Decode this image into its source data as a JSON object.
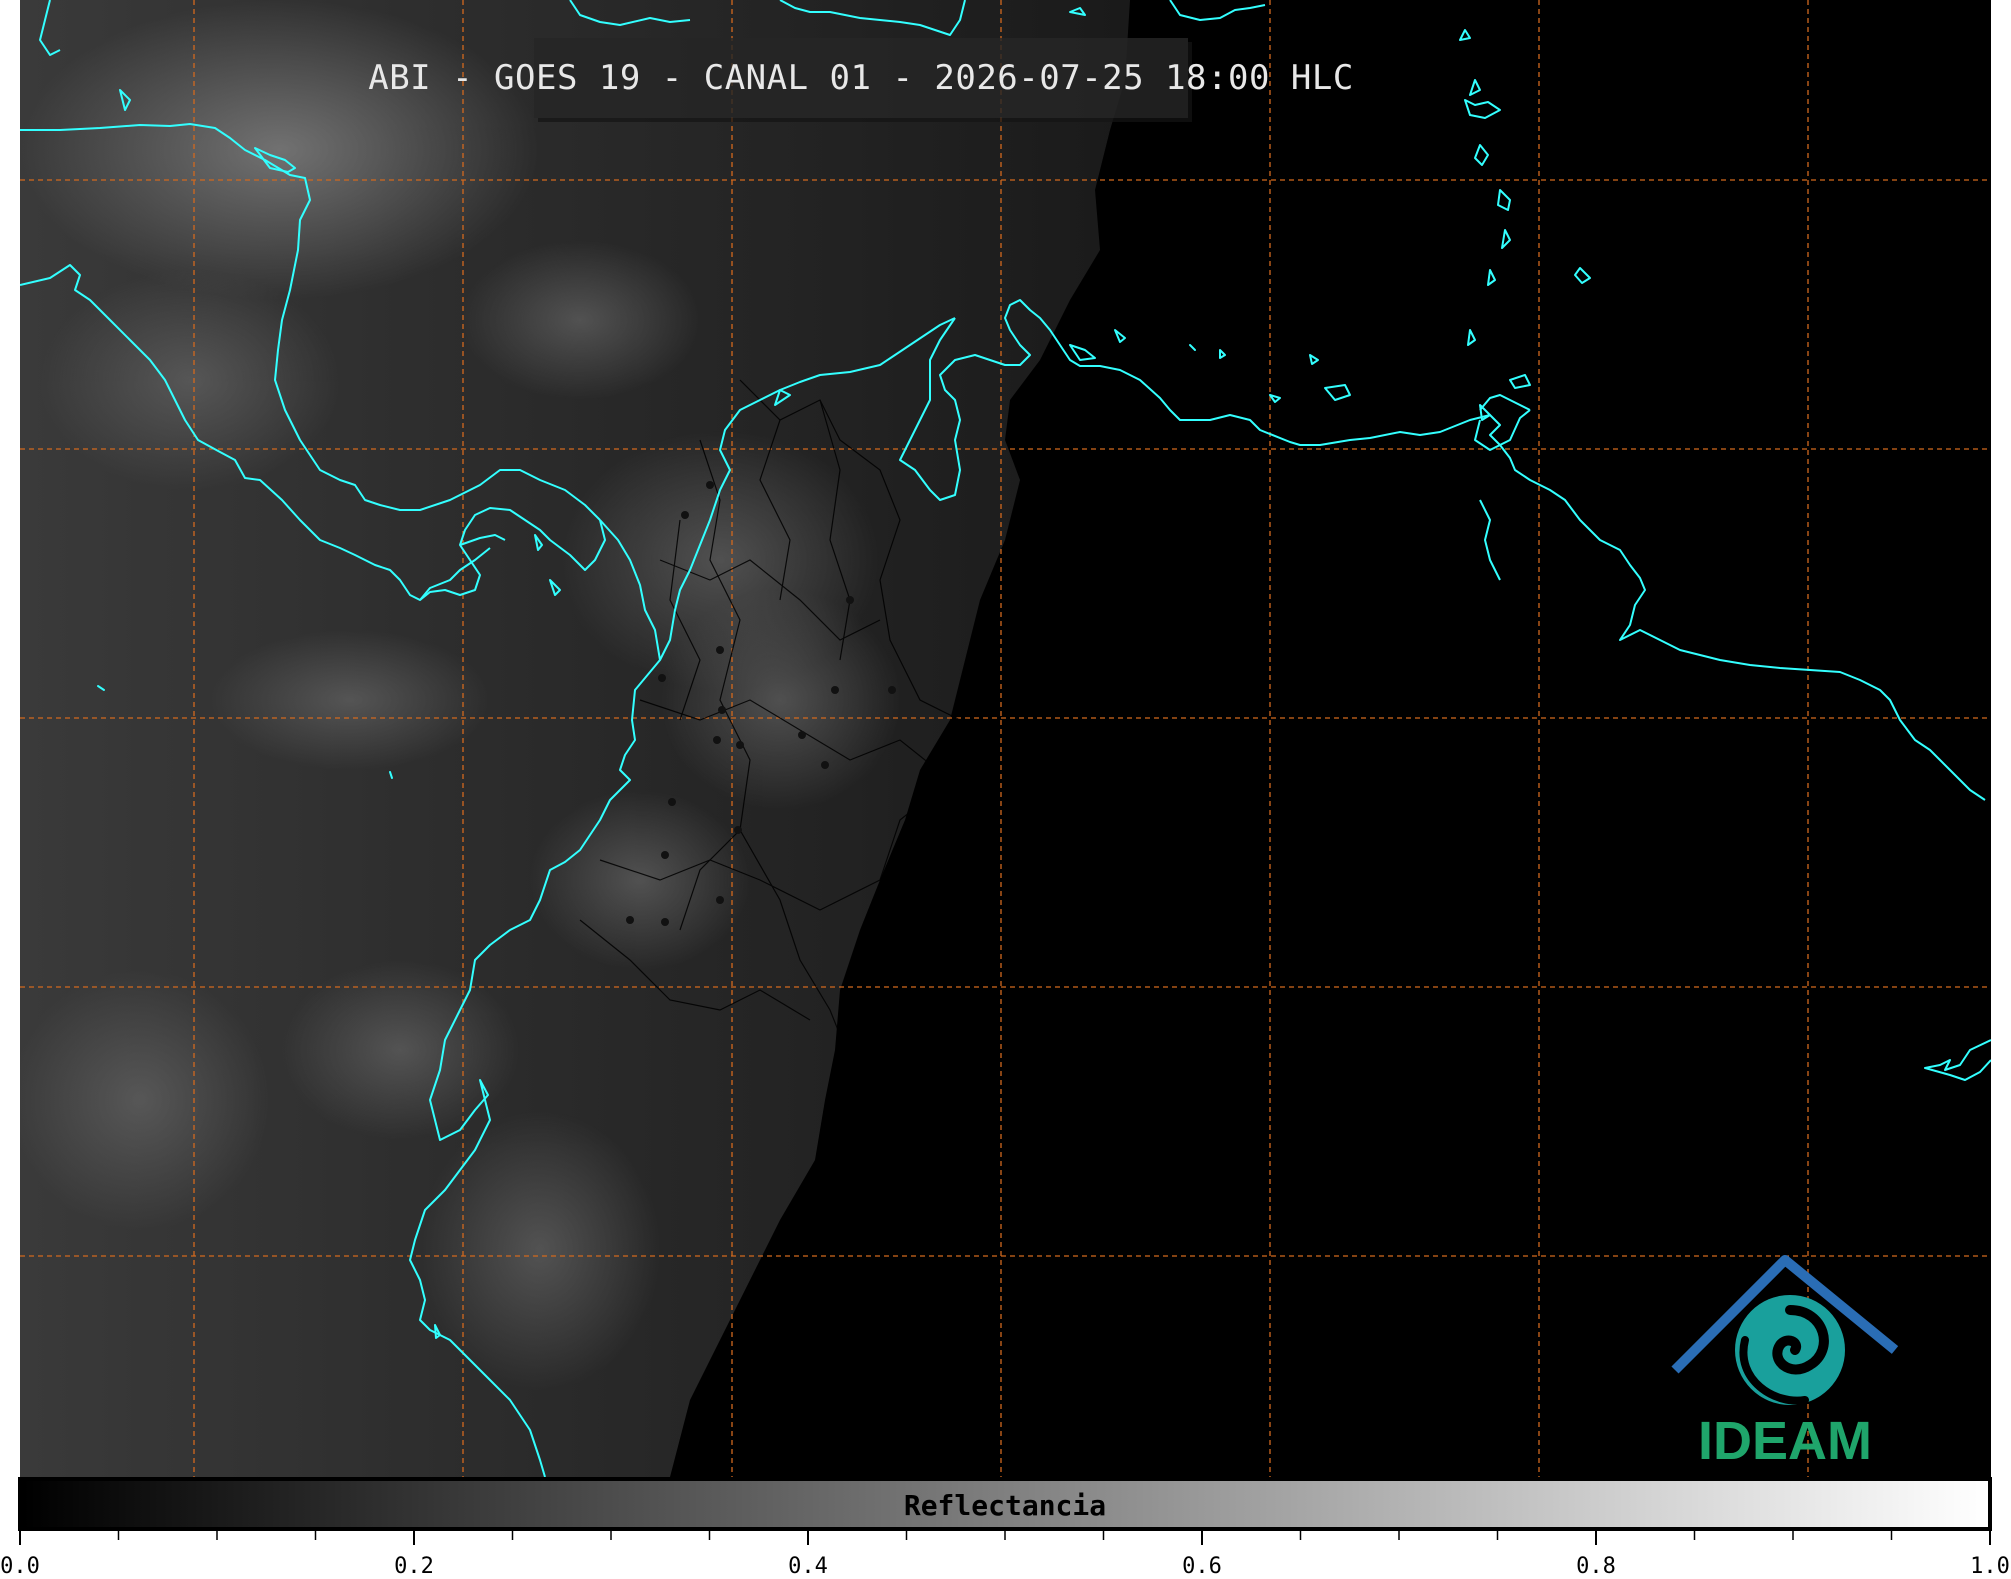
{
  "title": "ABI - GOES 19 - CANAL 01 - 2026-07-25 18:00 HLC",
  "colorbar": {
    "label": "Reflectancia",
    "ticks": [
      "0.0",
      "0.2",
      "0.4",
      "0.6",
      "0.8",
      "1.0"
    ],
    "range": [
      0.0,
      1.0
    ],
    "colormap": "grayscale",
    "min_color": "#000000",
    "max_color": "#ffffff"
  },
  "logo": {
    "text": "IDEAM"
  },
  "colors": {
    "coastline": "#33ffff",
    "graticule": "#d2691e",
    "borders": "#000000",
    "background": "#000000"
  }
}
